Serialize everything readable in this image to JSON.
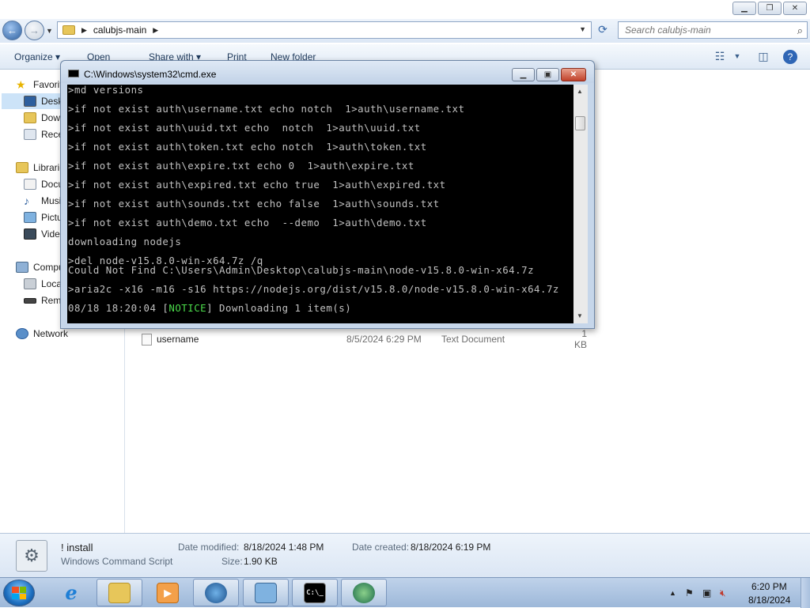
{
  "explorer": {
    "address": {
      "crumbs": [
        "calubjs-main"
      ]
    },
    "search": {
      "placeholder": "Search calubjs-main"
    },
    "toolbar": {
      "organize": "Organize",
      "open": "Open",
      "share_with": "Share with",
      "print": "Print",
      "new_folder": "New folder"
    },
    "nav_pane": {
      "favorites": "Favorites",
      "desktop": "Desktop",
      "downloads": "Downloads",
      "recent": "Recent Places",
      "libraries": "Libraries",
      "documents": "Documents",
      "music": "Music",
      "pictures": "Pictures",
      "videos": "Videos",
      "computer": "Computer",
      "local_disk": "Local Disk (C:)",
      "removable": "Removable Disk",
      "network": "Network"
    },
    "files": [
      {
        "name": "username",
        "date": "8/5/2024 6:29 PM",
        "type": "Text Document",
        "size": "1 KB"
      }
    ],
    "details": {
      "name": "! install",
      "type": "Windows Command Script",
      "modified_label": "Date modified:",
      "modified": "8/18/2024 1:48 PM",
      "size_label": "Size:",
      "size": "1.90 KB",
      "created_label": "Date created:",
      "created": "8/18/2024 6:19 PM"
    }
  },
  "cmd": {
    "title": "C:\\Windows\\system32\\cmd.exe",
    "lines": [
      ">md versions",
      ">if not exist auth\\username.txt echo notch  1>auth\\username.txt",
      ">if not exist auth\\uuid.txt echo  notch  1>auth\\uuid.txt",
      ">if not exist auth\\token.txt echo notch  1>auth\\token.txt",
      ">if not exist auth\\expire.txt echo 0  1>auth\\expire.txt",
      ">if not exist auth\\expired.txt echo true  1>auth\\expired.txt",
      ">if not exist auth\\sounds.txt echo false  1>auth\\sounds.txt",
      ">if not exist auth\\demo.txt echo  --demo  1>auth\\demo.txt",
      "downloading nodejs",
      ">del node-v15.8.0-win-x64.7z /q",
      "Could Not Find C:\\Users\\Admin\\Desktop\\calubjs-main\\node-v15.8.0-win-x64.7z",
      ">aria2c -x16 -m16 -s16 https://nodejs.org/dist/v15.8.0/node-v15.8.0-win-x64.7z"
    ],
    "last_line": {
      "prefix": "08/18 18:20:04 [",
      "notice": "NOTICE",
      "suffix": "] Downloading 1 item(s)"
    }
  },
  "taskbar": {
    "time": "6:20 PM",
    "date": "8/18/2024"
  },
  "colors": {
    "console_bg": "#000000",
    "console_text": "#c0c0c0",
    "notice": "#4bdc4b",
    "selection": "#cce3f8"
  }
}
